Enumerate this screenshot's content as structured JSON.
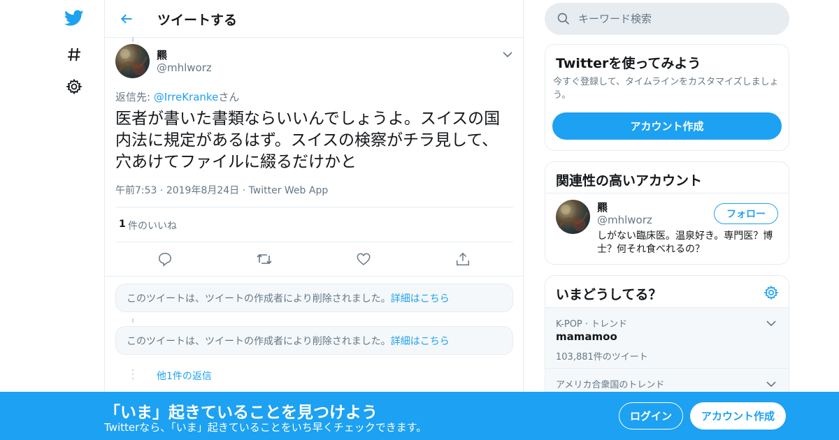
{
  "nav": {
    "icons": [
      "twitter-logo-icon",
      "hashtag-icon",
      "gear-icon"
    ]
  },
  "header": {
    "title": "ツイートする"
  },
  "tweet": {
    "name": "羆",
    "handle": "@mhlworz",
    "reply_prefix": "返信先: ",
    "reply_to": "@IrreKranke",
    "reply_suffix": "さん",
    "text": "医者が書いた書類ならいいんでしょうよ。スイスの国内法に規定があるはず。スイスの検察がチラ見して、穴あけてファイルに綴るだけかと",
    "time": "午前7:53",
    "date": "2019年8月24日",
    "source": "Twitter Web App",
    "sep": "·",
    "likes_count": "1",
    "likes_label": "件のいいね"
  },
  "replies": {
    "deleted_text": "このツイートは、ツイートの作成者により削除されました。",
    "deleted_link": "詳細はこちら",
    "more_replies": "他1件の返信"
  },
  "search": {
    "placeholder": "キーワード検索"
  },
  "signup_card": {
    "title": "Twitterを使ってみよう",
    "subtitle": "今すぐ登録して、タイムラインをカスタマイズしましょう。",
    "button": "アカウント作成"
  },
  "related_card": {
    "title": "関連性の高いアカウント",
    "name": "羆",
    "handle": "@mhlworz",
    "follow": "フォロー",
    "bio": "しがない臨床医。温泉好き。専門医？博士？何それ食べれるの？"
  },
  "trends_card": {
    "title": "いまどうしてる？",
    "items": [
      {
        "category": "K-POP · トレンド",
        "name": "mamamoo",
        "count": "103,881件のツイート"
      },
      {
        "category": "アメリカ合衆国のトレンド",
        "name": "",
        "count": ""
      }
    ]
  },
  "banner": {
    "title": "「いま」起きていることを見つけよう",
    "subtitle": "Twitterなら、「いま」起きていることをいち早くチェックできます。",
    "login": "ログイン",
    "signup": "アカウント作成"
  },
  "colors": {
    "brand": "#1da1f2",
    "text": "#14171a",
    "secondary": "#657786",
    "border": "#e6ecf0"
  }
}
